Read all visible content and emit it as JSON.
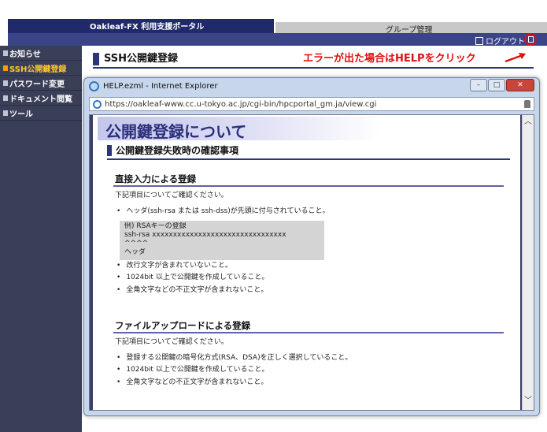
{
  "portal": {
    "title": "Oakleaf-FX 利用支援ポータル",
    "group_tab": "グループ管理",
    "logout_label": "ログアウト",
    "section_title": "SSH公開鍵登録",
    "annotation": "エラーが出た場合はHELPをクリック",
    "sidebar": [
      {
        "label": "お知らせ",
        "active": false
      },
      {
        "label": "SSH公開鍵登録",
        "active": true
      },
      {
        "label": "パスワード変更",
        "active": false
      },
      {
        "label": "ドキュメント閲覧",
        "active": false
      },
      {
        "label": "ツール",
        "active": false
      }
    ]
  },
  "browser": {
    "title": "HELP.ezml - Internet Explorer",
    "url": "https://oakleaf-www.cc.u-tokyo.ac.jp/cgi-bin/hpcportal_gm.ja/view.cgi",
    "buttons": {
      "minimize": "–",
      "maximize": "□",
      "close": "✕"
    }
  },
  "help": {
    "banner": "公開鍵登録について",
    "heading": "公開鍵登録失敗時の確認事項",
    "direct": {
      "title": "直接入力による登録",
      "intro": "下記項目についてご確認ください。",
      "item1": "ヘッダ(ssh-rsa または ssh-dss)が先頭に付与されていること。",
      "example": [
        "例) RSAキーの登録",
        "ssh-rsa xxxxxxxxxxxxxxxxxxxxxxxxxxxxxxxx",
        "^^^^",
        "ヘッダ"
      ],
      "items": [
        "改行文字が含まれていないこと。",
        "1024bit 以上で公開鍵を作成していること。",
        "全角文字などの不正文字が含まれないこと。"
      ]
    },
    "upload": {
      "title": "ファイルアップロードによる登録",
      "intro": "下記項目についてご確認ください。",
      "items": [
        "登録する公開鍵の暗号化方式(RSA、DSA)を正しく選択していること。",
        "1024bit 以上で公開鍵を作成していること。",
        "全角文字などの不正文字が含まれないこと。"
      ]
    }
  },
  "colors": {
    "annotation": "#e01010",
    "navy": "#2c3578",
    "sidebar": "#3a3f58"
  }
}
